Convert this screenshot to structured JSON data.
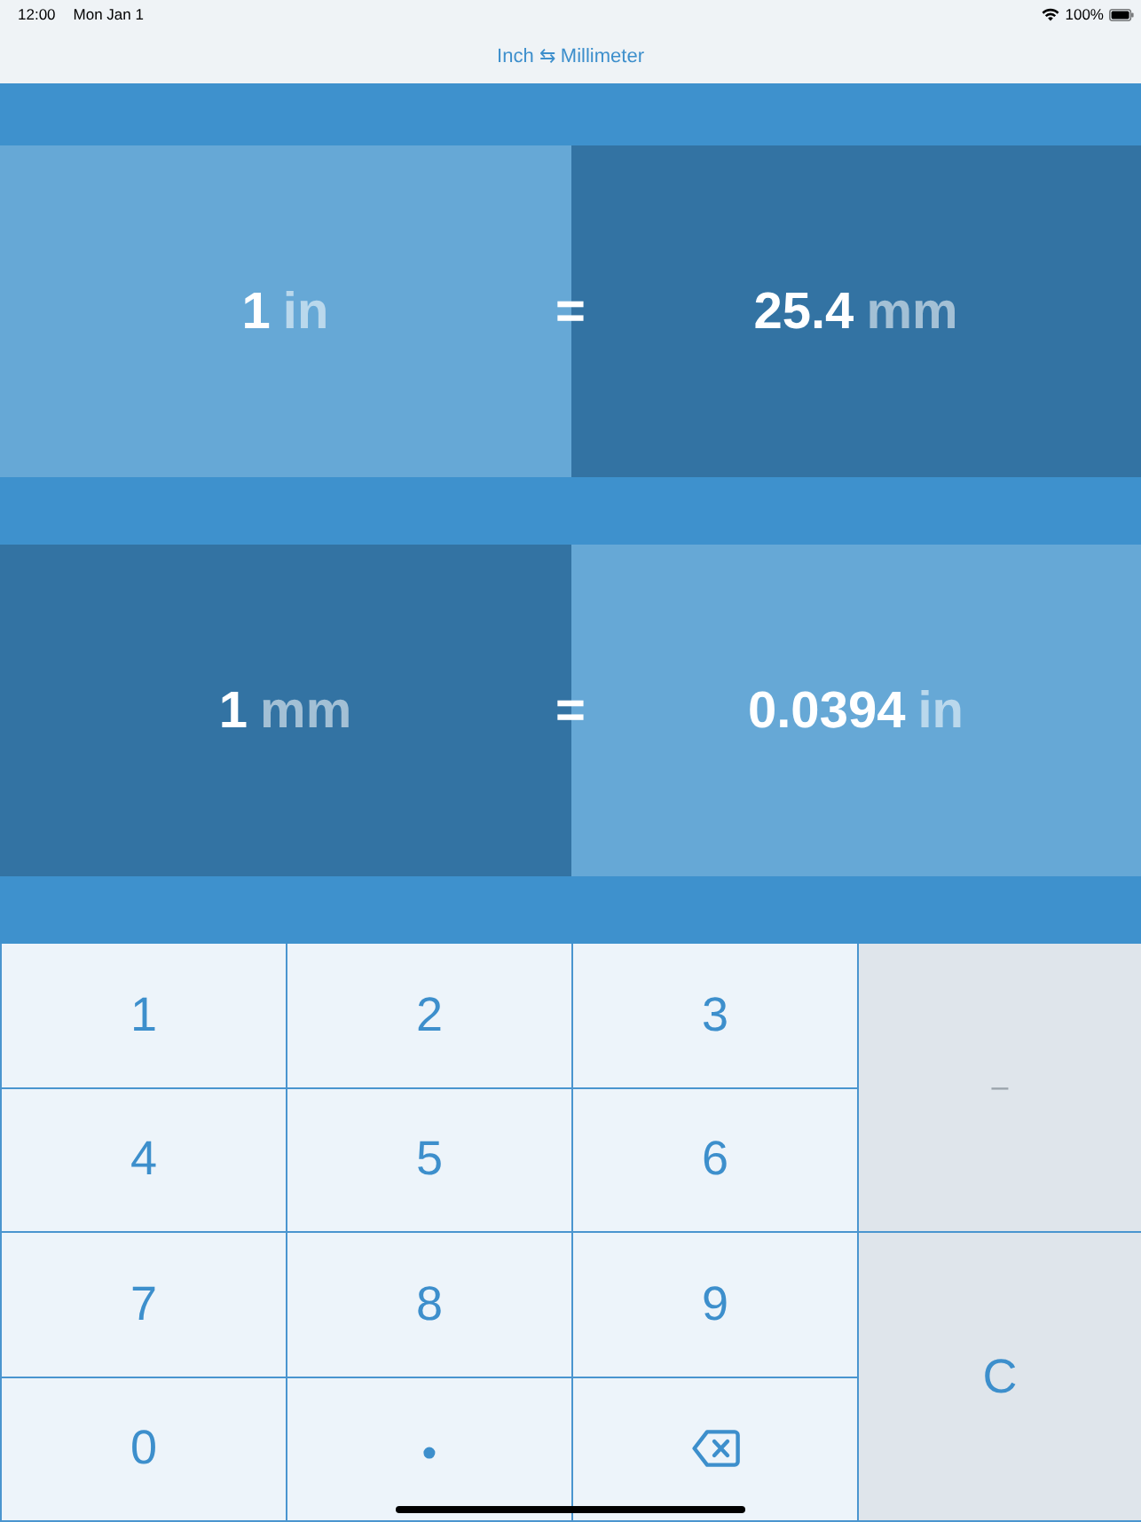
{
  "status_bar": {
    "time": "12:00",
    "date": "Mon Jan 1",
    "battery": "100%"
  },
  "nav_bar": {
    "title": "Inch ⇆ Millimeter"
  },
  "conversions": [
    {
      "sign": "=",
      "sides": [
        {
          "value": "1",
          "unit": "in",
          "color": "#66a8d6"
        },
        {
          "value": "25.4",
          "unit": "mm",
          "color": "#3373a3"
        }
      ]
    },
    {
      "sign": "=",
      "sides": [
        {
          "value": "1",
          "unit": "mm",
          "color": "#3373a3"
        },
        {
          "value": "0.0394",
          "unit": "in",
          "color": "#66a8d6"
        }
      ]
    }
  ],
  "keypad": {
    "keys": [
      {
        "kind": "digit",
        "label": "1",
        "disabled": false
      },
      {
        "kind": "digit",
        "label": "2",
        "disabled": false
      },
      {
        "kind": "digit",
        "label": "3",
        "disabled": false
      },
      {
        "kind": "sign",
        "label": "–",
        "disabled": true
      },
      {
        "kind": "digit",
        "label": "4",
        "disabled": false
      },
      {
        "kind": "digit",
        "label": "5",
        "disabled": false
      },
      {
        "kind": "digit",
        "label": "6",
        "disabled": false
      },
      {
        "kind": "digit",
        "label": "7",
        "disabled": false
      },
      {
        "kind": "digit",
        "label": "8",
        "disabled": false
      },
      {
        "kind": "digit",
        "label": "9",
        "disabled": false
      },
      {
        "kind": "clear",
        "label": "C",
        "disabled": false
      },
      {
        "kind": "digit",
        "label": "0",
        "disabled": false
      },
      {
        "kind": "point",
        "label": "•",
        "disabled": false
      },
      {
        "kind": "backspace",
        "disabled": false
      }
    ]
  }
}
